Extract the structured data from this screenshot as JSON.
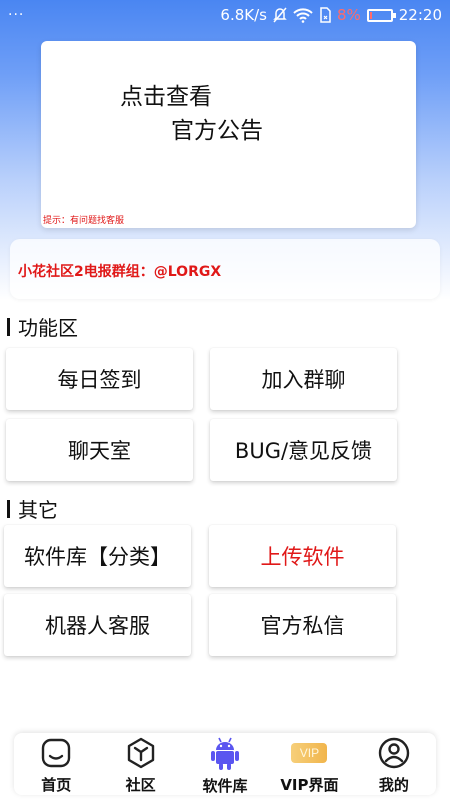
{
  "status_bar": {
    "dots": "···",
    "speed": "6.8K/s",
    "battery_pct": "8%",
    "time": "22:20"
  },
  "notice": {
    "line1": "点击查看",
    "line2": "官方公告",
    "hint": "提示：有问题找客服"
  },
  "group": {
    "text": "小花社区2电报群组：@LORGX"
  },
  "sections": {
    "functions_title": "功能区",
    "others_title": "其它"
  },
  "buttons": {
    "checkin": "每日签到",
    "join_group": "加入群聊",
    "chat_room": "聊天室",
    "feedback": "BUG/意见反馈",
    "software_library": "软件库【分类】",
    "upload_software": "上传软件",
    "robot_service": "机器人客服",
    "official_message": "官方私信"
  },
  "bottom_nav": {
    "home": "首页",
    "community": "社区",
    "software": "软件库",
    "vip": "VIP界面",
    "vip_badge": "VIP",
    "mine": "我的"
  },
  "colors": {
    "accent_red": "#e01818",
    "header_blue": "#4a86f2",
    "android_purple": "#5a55f0"
  }
}
